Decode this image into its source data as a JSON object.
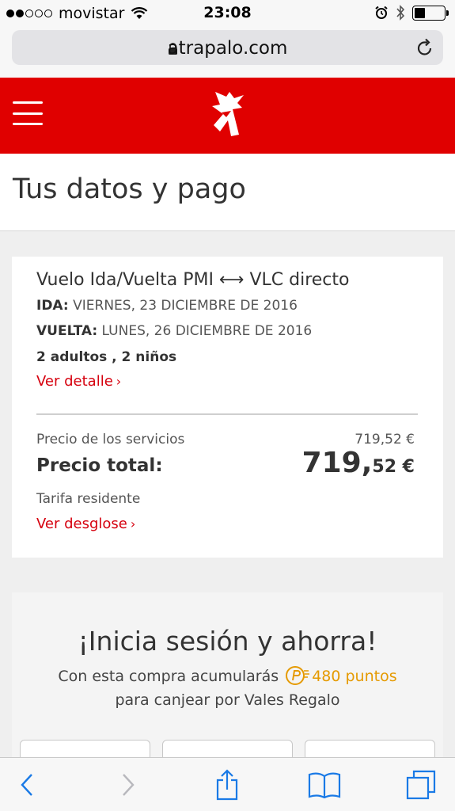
{
  "status_bar": {
    "carrier": "movistar",
    "time": "23:08",
    "signal_bars_filled": 2,
    "signal_bars_total": 5,
    "battery_level": 0.35
  },
  "browser": {
    "url": "atrapalo.com"
  },
  "header": {
    "brand_color": "#e00000"
  },
  "page": {
    "title": "Tus datos y pago"
  },
  "summary": {
    "flight_title": "Vuelo Ida/Vuelta PMI ⟷ VLC directo",
    "ida_label": "IDA:",
    "ida_date": " VIERNES, 23 DICIEMBRE DE 2016",
    "vuelta_label": "VUELTA:",
    "vuelta_date": " LUNES, 26 DICIEMBRE DE 2016",
    "passengers": "2 adultos , 2 niños",
    "detail_link": "Ver detalle",
    "services_label": "Precio de los servicios",
    "services_value": "719,52 €",
    "total_label": "Precio total:",
    "total_int": "719,",
    "total_dec": "52 €",
    "fare_label": "Tarifa residente",
    "breakdown_link": "Ver desglose",
    "link_color": "#d6000e"
  },
  "login": {
    "title": "¡Inicia sesión y ahorra!",
    "subtitle_prefix": "Con esta compra acumularás ",
    "points": "480 puntos",
    "subtitle_line2": "para canjear por Vales Regalo",
    "points_color": "#e59a00"
  },
  "toolbar": {
    "icons": [
      "back-icon",
      "forward-icon",
      "share-icon",
      "bookmarks-icon",
      "tabs-icon"
    ],
    "accent": "#1a7ae6"
  }
}
